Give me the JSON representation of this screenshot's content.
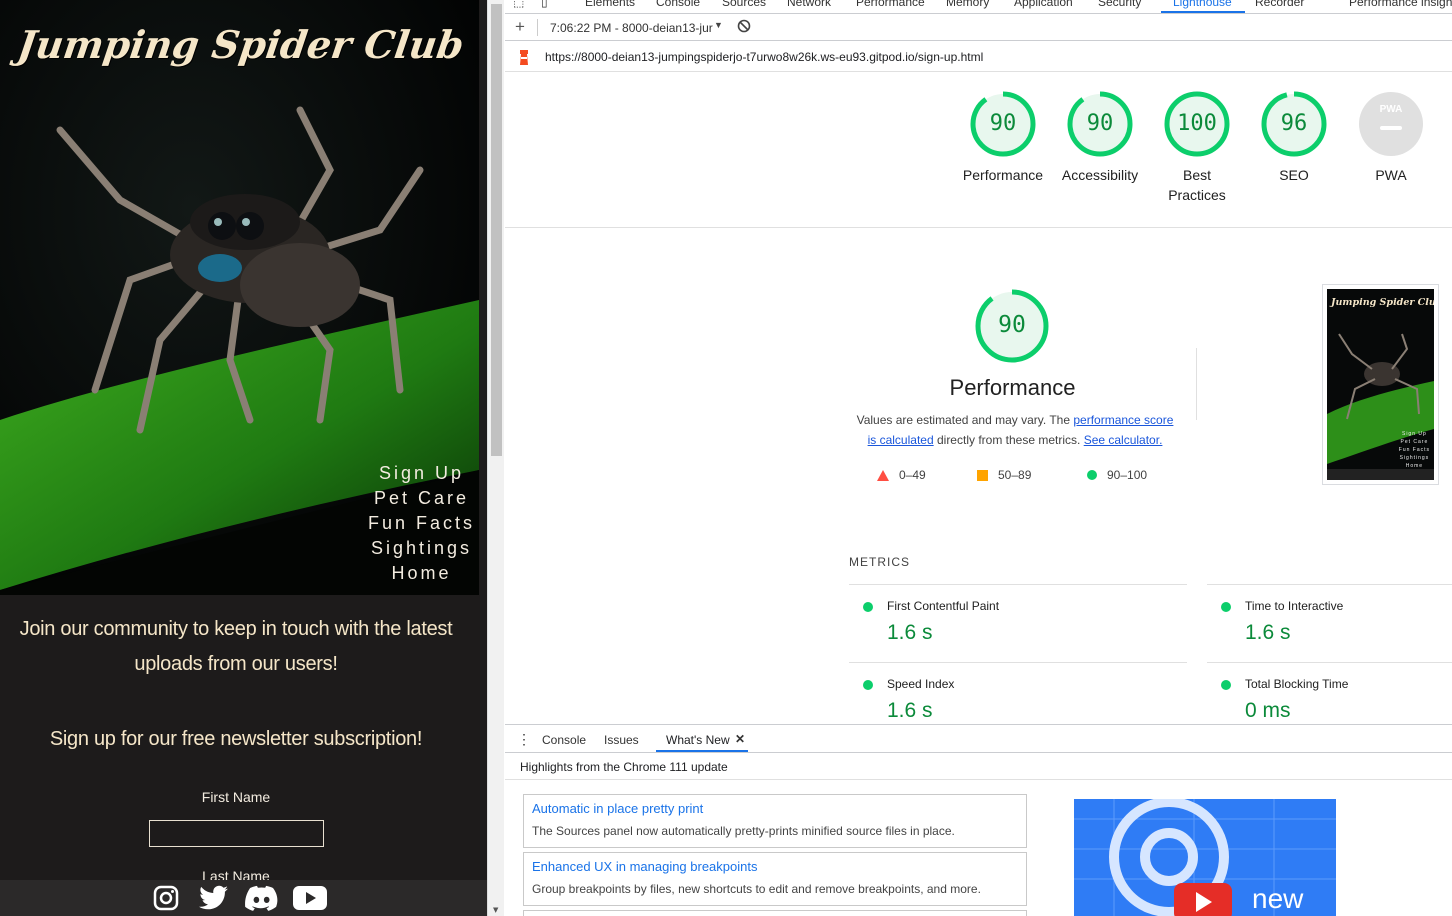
{
  "website": {
    "title": "Jumping Spider Club",
    "nav": [
      "Sign Up",
      "Pet Care",
      "Fun Facts",
      "Sightings",
      "Home"
    ],
    "community_text": "Join our community to keep in touch with the latest uploads from our users!",
    "newsletter_text": "Sign up for our free newsletter subscription!",
    "form": {
      "first_name_label": "First Name",
      "first_name_value": "",
      "last_name_label": "Last Name"
    },
    "social_icons": [
      "instagram-icon",
      "twitter-icon",
      "discord-icon",
      "youtube-icon"
    ]
  },
  "devtools": {
    "tabs": [
      "Elements",
      "Console",
      "Sources",
      "Network",
      "Performance",
      "Memory",
      "Application",
      "Security",
      "Lighthouse",
      "Recorder",
      "Performance insights"
    ],
    "active_tab": "Lighthouse",
    "toolbar": {
      "report_label": "7:06:22 PM - 8000-deian13-jur"
    },
    "url": "https://8000-deian13-jumpingspiderjo-t7urwo8w26k.ws-eu93.gitpod.io/sign-up.html",
    "scores": [
      {
        "label": "Performance",
        "value": "90"
      },
      {
        "label": "Accessibility",
        "value": "90"
      },
      {
        "label": "Best Practices",
        "value": "100"
      },
      {
        "label": "SEO",
        "value": "96"
      },
      {
        "label": "PWA",
        "value": ""
      }
    ],
    "pwa_badge": "PWA",
    "performance": {
      "score": "90",
      "title": "Performance",
      "desc_1": "Values are estimated and may vary. The ",
      "link_1": "performance score is calculated",
      "desc_2": " directly from these metrics. ",
      "link_2": "See calculator.",
      "legend": [
        "0–49",
        "50–89",
        "90–100"
      ]
    },
    "thumbnail": {
      "title": "Jumping Spider Club",
      "nav": [
        "Sign Up",
        "Pet Care",
        "Fun Facts",
        "Sightings",
        "Home"
      ]
    },
    "metrics_title": "METRICS",
    "metrics": [
      {
        "name": "First Contentful Paint",
        "value": "1.6 s"
      },
      {
        "name": "Time to Interactive",
        "value": "1.6 s"
      },
      {
        "name": "Speed Index",
        "value": "1.6 s"
      },
      {
        "name": "Total Blocking Time",
        "value": "0 ms"
      }
    ],
    "drawer": {
      "tabs": [
        "Console",
        "Issues",
        "What's New"
      ],
      "active": "What's New",
      "heading": "Highlights from the Chrome 111 update",
      "cards": [
        {
          "title": "Automatic in place pretty print",
          "desc": "The Sources panel now automatically pretty-prints minified source files in place."
        },
        {
          "title": "Enhanced UX in managing breakpoints",
          "desc": "Group breakpoints by files, new shortcuts to edit and remove breakpoints, and more."
        }
      ],
      "video_text": "new"
    },
    "colors": {
      "pass": "#0cce6b",
      "pass_text": "#0b8a3a",
      "average": "#ffa400",
      "fail": "#ff4e42",
      "accent": "#1a73e8"
    }
  }
}
